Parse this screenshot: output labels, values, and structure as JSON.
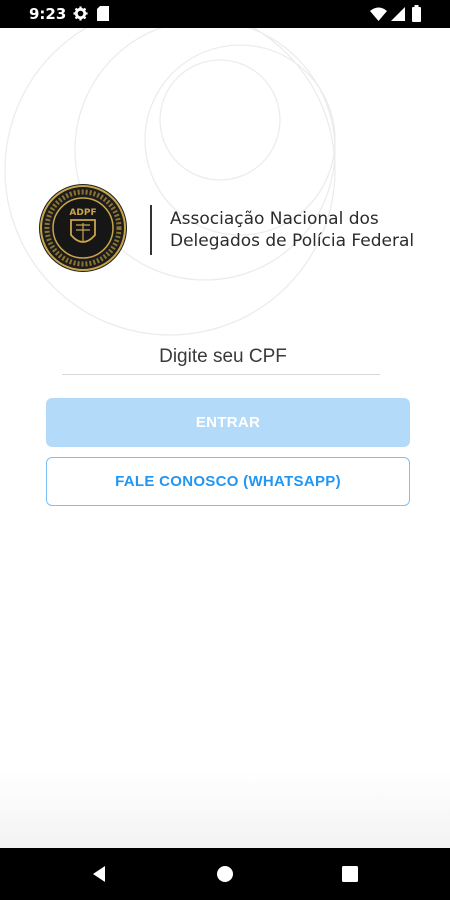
{
  "status_bar": {
    "time": "9:23",
    "left_icons": [
      "gear-icon",
      "sd-card-icon"
    ],
    "right_icons": [
      "wifi-icon",
      "signal-icon",
      "battery-icon"
    ]
  },
  "branding": {
    "seal_text": "ADPF",
    "org_name_line1": "Associação Nacional dos",
    "org_name_line2": "Delegados de Polícia Federal"
  },
  "login": {
    "cpf_placeholder": "Digite seu CPF",
    "cpf_value": "",
    "enter_label": "ENTRAR",
    "contact_label": "FALE CONOSCO (WHATSAPP)"
  },
  "nav_bar": {
    "buttons": [
      "back-icon",
      "home-icon",
      "recents-icon"
    ]
  },
  "colors": {
    "primary_disabled": "#b3dbf9",
    "accent": "#2196f3",
    "seal_gold": "#c9a54a"
  }
}
